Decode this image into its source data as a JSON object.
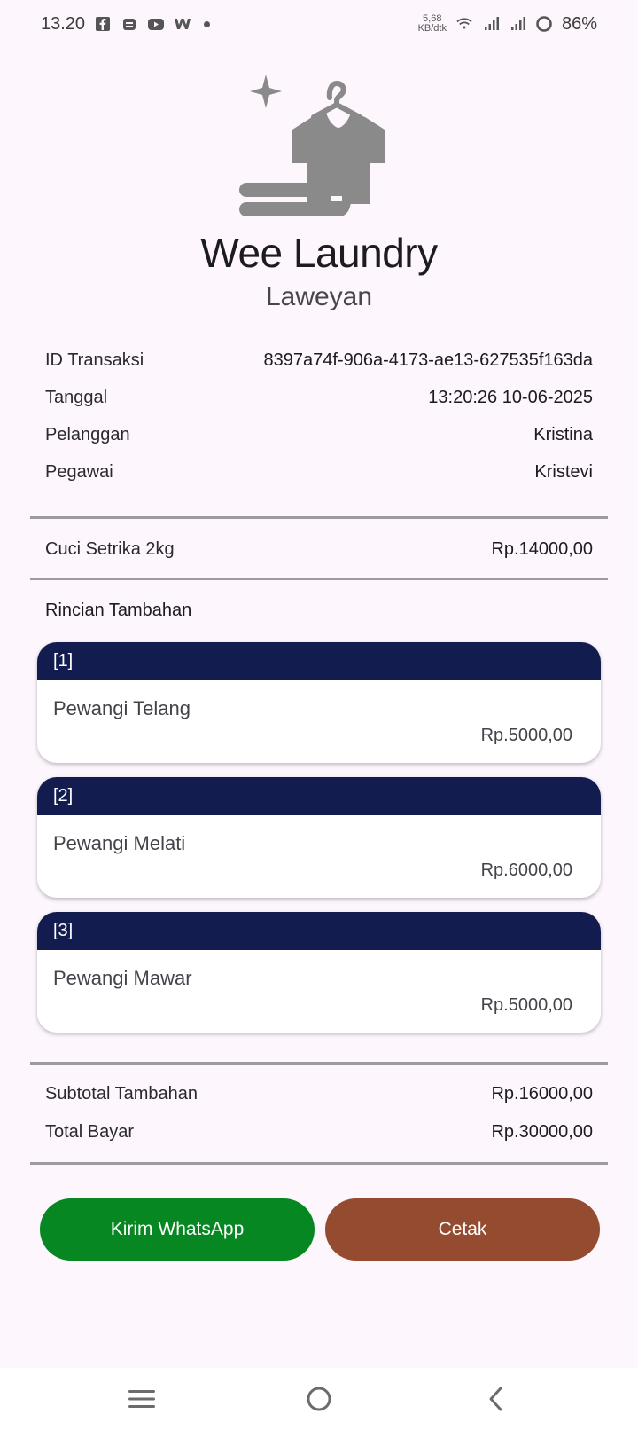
{
  "status_bar": {
    "time": "13.20",
    "net_speed_value": "5,68",
    "net_speed_unit": "KB/dtk",
    "battery": "86%",
    "icons": [
      "facebook-icon",
      "app-icon",
      "youtube-icon",
      "webtoon-icon",
      "wifi-icon",
      "signal-icon",
      "signal-icon",
      "battery-icon"
    ]
  },
  "header": {
    "logo_icon": "laundry-shirt-icon",
    "brand": "Wee Laundry",
    "branch": "Laweyan"
  },
  "transaction": {
    "rows": [
      {
        "label": "ID Transaksi",
        "value": "8397a74f-906a-4173-ae13-627535f163da"
      },
      {
        "label": "Tanggal",
        "value": "13:20:26 10-06-2025"
      },
      {
        "label": "Pelanggan",
        "value": "Kristina"
      },
      {
        "label": "Pegawai",
        "value": "Kristevi"
      }
    ]
  },
  "service": {
    "name": "Cuci Setrika 2kg",
    "price": "Rp.14000,00"
  },
  "extras": {
    "label": "Rincian Tambahan",
    "items": [
      {
        "index": "[1]",
        "name": "Pewangi Telang",
        "price": "Rp.5000,00"
      },
      {
        "index": "[2]",
        "name": "Pewangi Melati",
        "price": "Rp.6000,00"
      },
      {
        "index": "[3]",
        "name": "Pewangi Mawar",
        "price": "Rp.5000,00"
      }
    ]
  },
  "totals": {
    "subtotal_label": "Subtotal Tambahan",
    "subtotal_value": "Rp.16000,00",
    "total_label": "Total Bayar",
    "total_value": "Rp.30000,00"
  },
  "actions": {
    "whatsapp_label": "Kirim WhatsApp",
    "print_label": "Cetak"
  },
  "colors": {
    "card_header": "#131c4f",
    "whatsapp_button": "#068721",
    "print_button": "#944b2f",
    "background": "#fdf6fd"
  }
}
